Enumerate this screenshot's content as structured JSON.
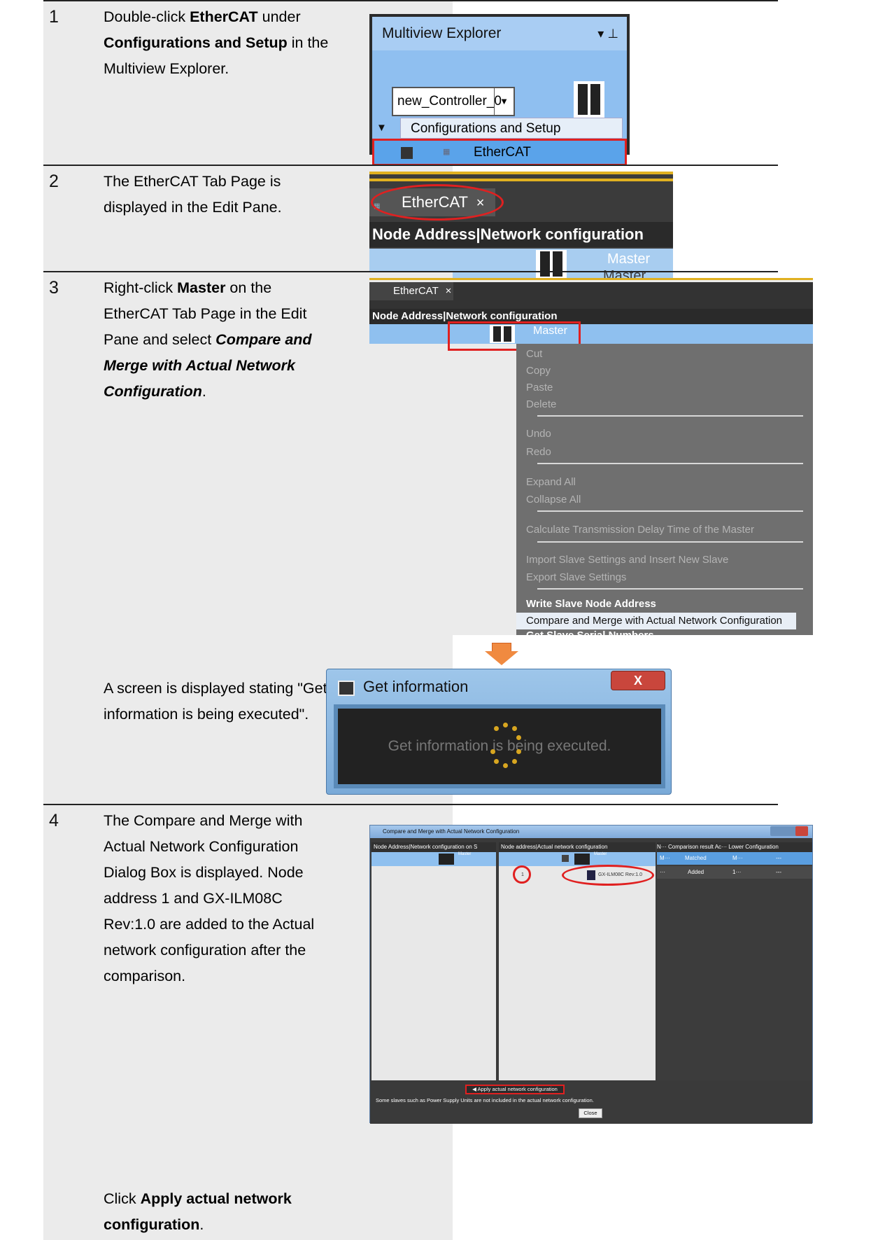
{
  "steps": [
    {
      "number": "1",
      "text": [
        "Double-click ",
        "EtherCAT",
        " under ",
        "Configurations and Setup",
        " in the Multiview Explorer."
      ],
      "screenshot": {
        "title": "Multiview Explorer",
        "pin": "▾ ⊥",
        "controller": "new_Controller_0",
        "section": "Configurations and Setup",
        "item": "EtherCAT"
      }
    },
    {
      "number": "2",
      "text": [
        "The EtherCAT Tab Page is displayed in the Edit Pane."
      ],
      "screenshot": {
        "tab": "EtherCAT",
        "close": "×",
        "header": "Node Address|Network configuration",
        "master_line1": "Master",
        "master_line2": "Master"
      }
    },
    {
      "number": "3",
      "text": [
        "Right-click ",
        "Master",
        " on the EtherCAT Tab Page in the Edit Pane and select ",
        "Compare and Merge with Actual Network Configuration",
        "."
      ],
      "screenshot": {
        "tab": "EtherCAT",
        "close": "×",
        "header": "Node Address|Network configuration",
        "master": "Master",
        "menu": [
          "Cut",
          "Copy",
          "Paste",
          "Delete",
          "Undo",
          "Redo",
          "Expand All",
          "Collapse All",
          "Calculate Transmission Delay Time of the Master",
          "Import Slave Settings and Insert New Slave",
          "Export Slave Settings",
          "Write Slave Node Address",
          "Compare and Merge with Actual Network Configuration",
          "Get Slave Serial Numbers"
        ]
      },
      "followup_text": "A screen is displayed stating \"Get information is being executed\".",
      "dialog": {
        "title": "Get information",
        "close": "X",
        "message": "Get information is being executed."
      }
    },
    {
      "number": "4",
      "text": [
        "The Compare and Merge with Actual Network Configuration Dialog Box is displayed. Node address 1 and GX-ILM08C Rev:1.0 are added to the Actual network configuration after the comparison."
      ],
      "action_prefix": "Click ",
      "action_bold": "Apply actual network configuration",
      "action_suffix": ".",
      "screenshot": {
        "title": "Compare and Merge with Actual Network Configuration",
        "left_header": "Node Address|Network configuration on S",
        "mid_header": "Node address|Actual network configuration",
        "right_header": "N··· Comparison result Ac··· Lower Configuration",
        "master1": "Master",
        "master2": "Master",
        "node": "1",
        "device": "GX-ILM08C Rev:1.0",
        "rows": [
          {
            "n": "M···",
            "result": "Matched",
            "ac": "M···",
            "lower": "---"
          },
          {
            "n": "···",
            "result": "Added",
            "ac": "1···",
            "lower": "---"
          }
        ],
        "apply_button": "◀ Apply actual network configuration",
        "note": "Some slaves such as Power Supply Units are not included in the actual network configuration.",
        "close_button": "Close"
      }
    }
  ]
}
